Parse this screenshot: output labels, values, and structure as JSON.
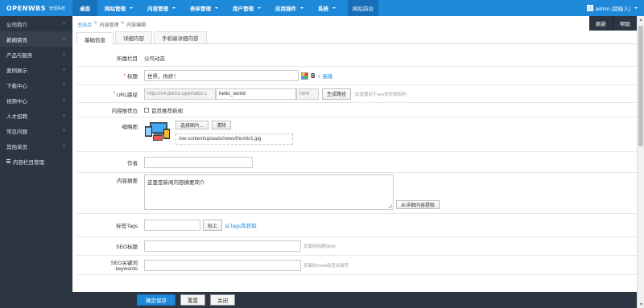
{
  "topbar": {
    "brand": "OPENWBS",
    "brand_sub": "管理系统",
    "nav": [
      {
        "label": "桌面",
        "dropdown": false,
        "active": true
      },
      {
        "label": "网站管理",
        "dropdown": true
      },
      {
        "label": "内容管理",
        "dropdown": true
      },
      {
        "label": "表单管理",
        "dropdown": true
      },
      {
        "label": "用户管理",
        "dropdown": true
      },
      {
        "label": "应用插件",
        "dropdown": true
      },
      {
        "label": "系统",
        "dropdown": true
      }
    ],
    "front_link": "网站前台",
    "user": "admin (超级人)"
  },
  "sidebar": {
    "items": [
      {
        "label": "公司简介"
      },
      {
        "label": "新闻资讯",
        "active": true
      },
      {
        "label": "产品与服务"
      },
      {
        "label": "案例展示"
      },
      {
        "label": "下载中心"
      },
      {
        "label": "视频中心"
      },
      {
        "label": "人才招聘"
      },
      {
        "label": "常见问题"
      },
      {
        "label": "其他单页"
      },
      {
        "label": "内容栏目管理"
      }
    ]
  },
  "breadcrumb": {
    "home": "主站点",
    "sep": ">",
    "level1": "内容管理",
    "level2": "内容编辑"
  },
  "top_actions": {
    "refresh": "刷新",
    "help": "帮助"
  },
  "tabs": [
    "基础信息",
    "详细内容",
    "手机端详细内容"
  ],
  "form": {
    "category": {
      "label": "所属栏目",
      "value": "公司动态"
    },
    "title": {
      "label": "标题",
      "value": "世界，你好！",
      "bold": "B",
      "more": "+ 高级"
    },
    "url": {
      "label": "URL路径",
      "prefix": "http://v4.demo.openwbs.c",
      "value": "hello_world",
      "suffix": "html",
      "button": "生成路径",
      "hint": "此设置对于seo优化很有利"
    },
    "recommend": {
      "label": "内容推荐位",
      "option": "首页推荐新闻"
    },
    "thumbnail": {
      "label": "缩略图",
      "select": "选择图片...",
      "delete": "清除",
      "path": "/ow-content/uploads/news/thumb/1.jpg"
    },
    "author": {
      "label": "作者",
      "value": ""
    },
    "summary": {
      "label": "内容摘要",
      "value": "这里是新闻内容摘要简介",
      "extract": "从详细内容提取"
    },
    "tags": {
      "label": "标签Tags",
      "paste": "贴上",
      "from_lib": "从Tags库获取"
    },
    "seo_title": {
      "label": "SEO标题",
      "hint": "页面的标题(title)"
    },
    "seo_keywords": {
      "label1": "SEO关键词",
      "label2": "keywords",
      "hint": "页面的meta标签关键字"
    }
  },
  "bottom": {
    "save": "确定保存",
    "reset": "重置",
    "close": "关闭"
  },
  "colors": {
    "accent": "#1e88d9",
    "sidebar": "#2b3642",
    "required": "#e33333"
  }
}
